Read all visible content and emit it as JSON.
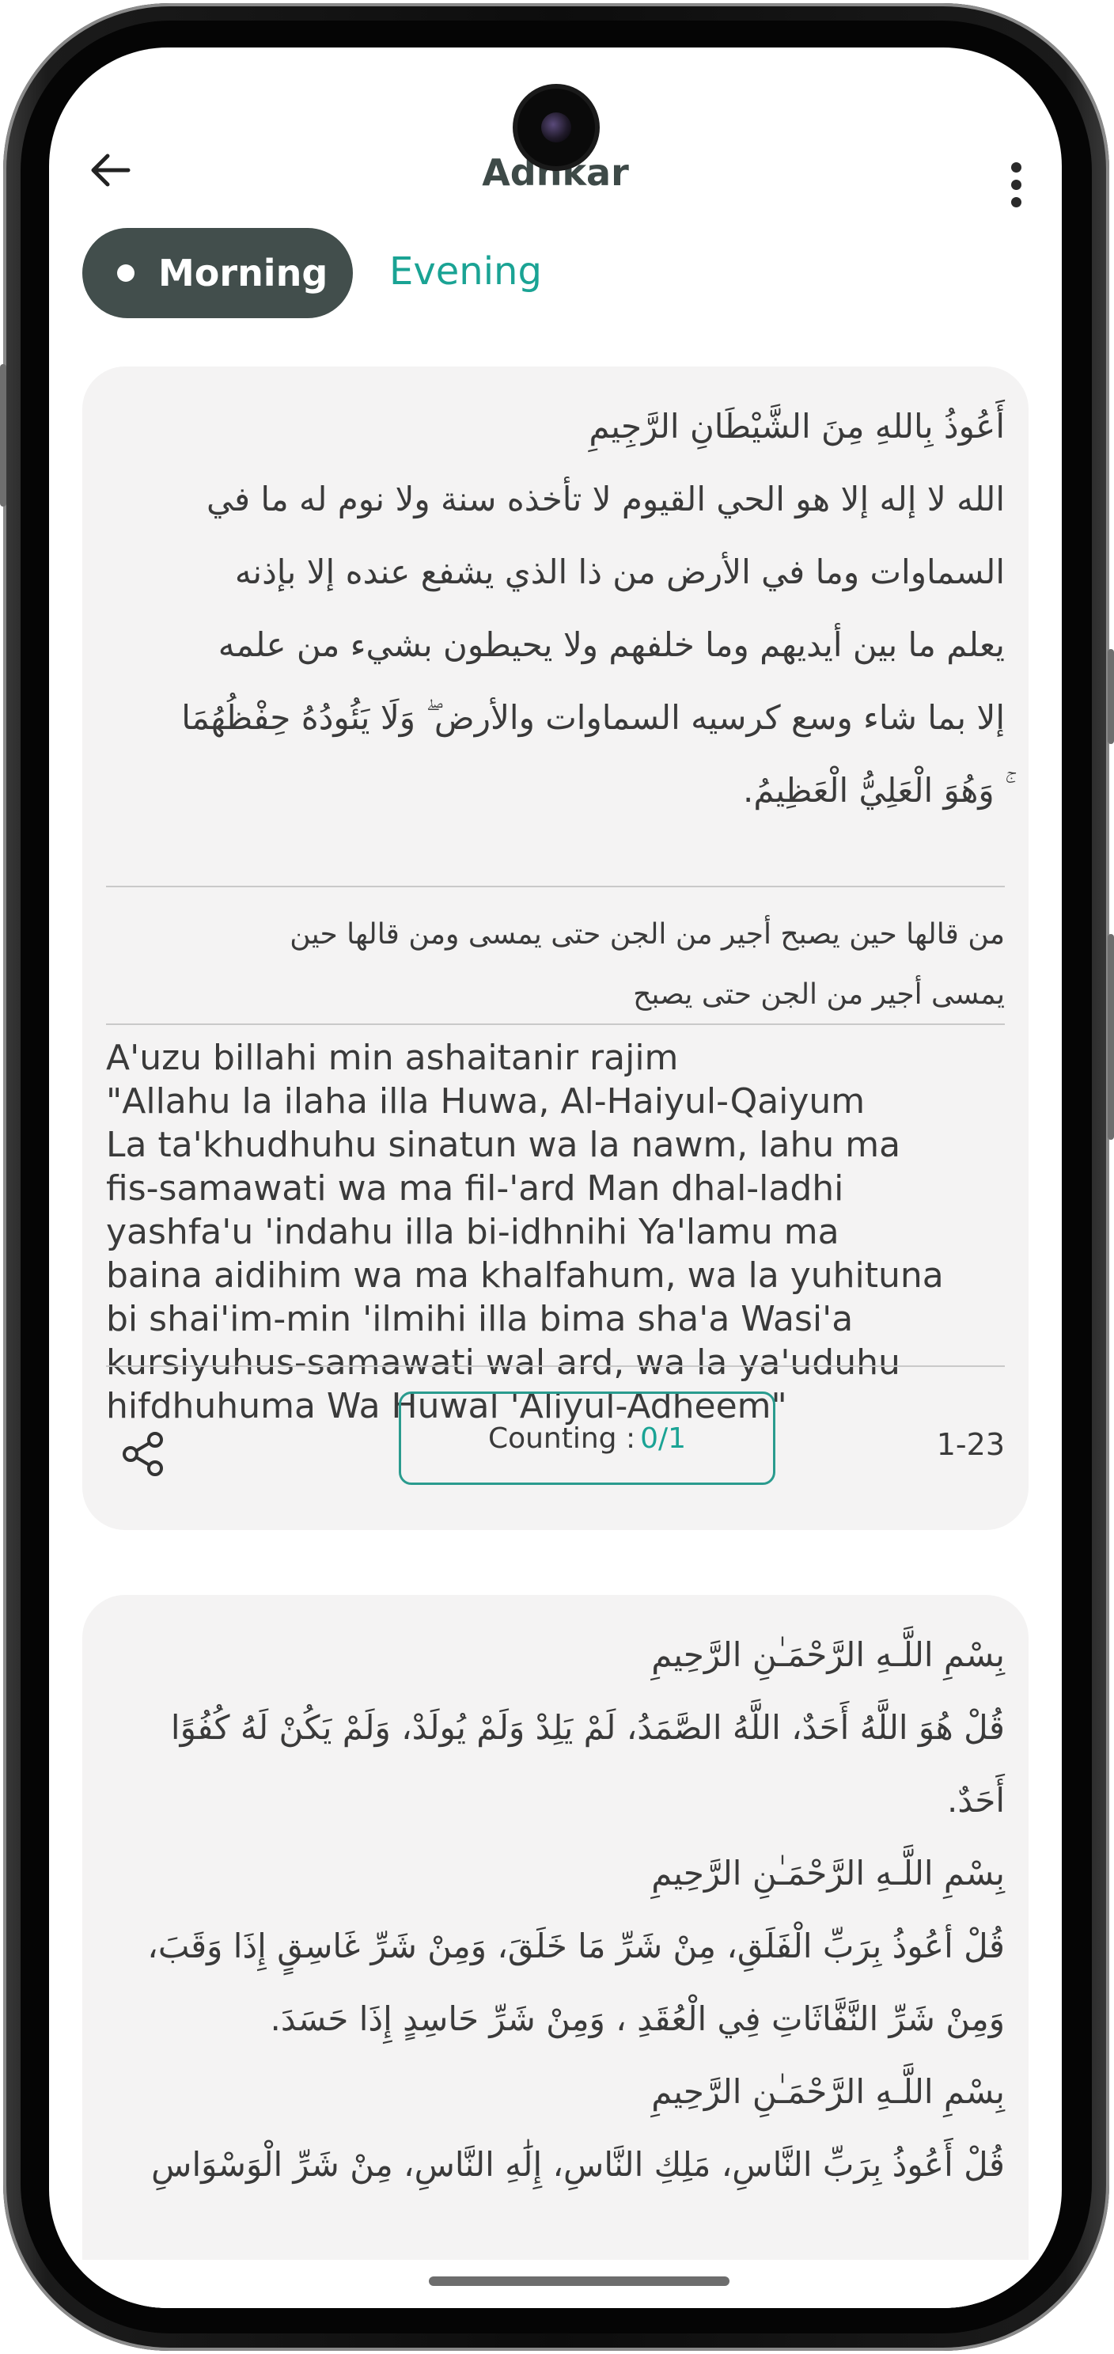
{
  "app_bar": {
    "title": "Adhkar",
    "back_icon": "arrow-left-icon",
    "more_icon": "more-vertical-icon"
  },
  "tabs": [
    {
      "label": "Morning",
      "selected": true
    },
    {
      "label": "Evening",
      "selected": false
    }
  ],
  "colors": {
    "accent": "#1aa394",
    "selected_tab_bg": "#424e4c",
    "card_bg": "#f4f3f3"
  },
  "cards": [
    {
      "arabic_lines": [
        "أَعُوذُ بِاللهِ مِنَ الشَّيْطَانِ الرَّجِيمِ",
        "الله لا إله إلا هو الحي القيوم لا تأخذه سنة ولا نوم له ما في",
        "السماوات وما في الأرض من ذا الذي يشفع عنده إلا بإذنه",
        "يعلم ما بين أيديهم وما خلفهم ولا يحيطون بشيء من علمه",
        "إلا بما شاء وسع كرسيه السماوات والأرض ۖ وَلَا يَئُودُهُ حِفْظُهُمَا",
        "ۚ وَهُوَ الْعَلِيُّ الْعَظِيمُ."
      ],
      "virtue_lines": [
        "من قالها حين يصبح أجير من الجن حتى يمسى ومن قالها حين",
        "يمسى أجير من الجن حتى يصبح"
      ],
      "transliteration": "A'uzu billahi min ashaitanir rajim\n\"Allahu la ilaha illa Huwa, Al-Haiyul-Qaiyum\nLa ta'khudhuhu sinatun wa la nawm, lahu ma\nfis-samawati wa ma fil-'ard Man dhal-ladhi\nyashfa'u 'indahu illa bi-idhnihi Ya'lamu ma\nbaina aidihim wa ma khalfahum, wa la yuhituna\nbi shai'im-min 'ilmihi illa bima sha'a Wasi'a\nkursiyuhus-samawati wal ard, wa la ya'uduhu\nhifdhuhuma Wa Huwal 'Aliyul-Adheem\"",
      "share_icon": "share-icon",
      "counting_label": "Counting :",
      "counting_value": "0/1",
      "range": "1-23"
    },
    {
      "arabic_lines": [
        "بِسْمِ اللَّـهِ الرَّحْمَـٰنِ الرَّحِيمِ",
        "قُلْ هُوَ اللَّهُ أَحَدٌ، اللَّهُ الصَّمَدُ، لَمْ يَلِدْ وَلَمْ يُولَدْ، وَلَمْ يَكُنْ لَهُ كُفُوًا",
        "أَحَدٌ.",
        "بِسْمِ اللَّـهِ الرَّحْمَـٰنِ الرَّحِيمِ",
        "قُلْ أعُوذُ بِرَبِّ الْفَلَقِ، مِنْ شَرِّ مَا خَلَقَ، وَمِنْ شَرِّ غَاسِقٍ إِذَا وَقَبَ،",
        "وَمِنْ شَرِّ النَّفَّاثَاتِ فِي الْعُقَدِ ، وَمِنْ شَرِّ حَاسِدٍ إِذَا حَسَدَ.",
        "بِسْمِ اللَّـهِ الرَّحْمَـٰنِ الرَّحِيمِ",
        "قُلْ أَعُوذُ بِرَبِّ النَّاسِ، مَلِكِ النَّاسِ، إِلَٰهِ النَّاسِ، مِنْ شَرِّ الْوَسْوَاسِ"
      ]
    }
  ]
}
